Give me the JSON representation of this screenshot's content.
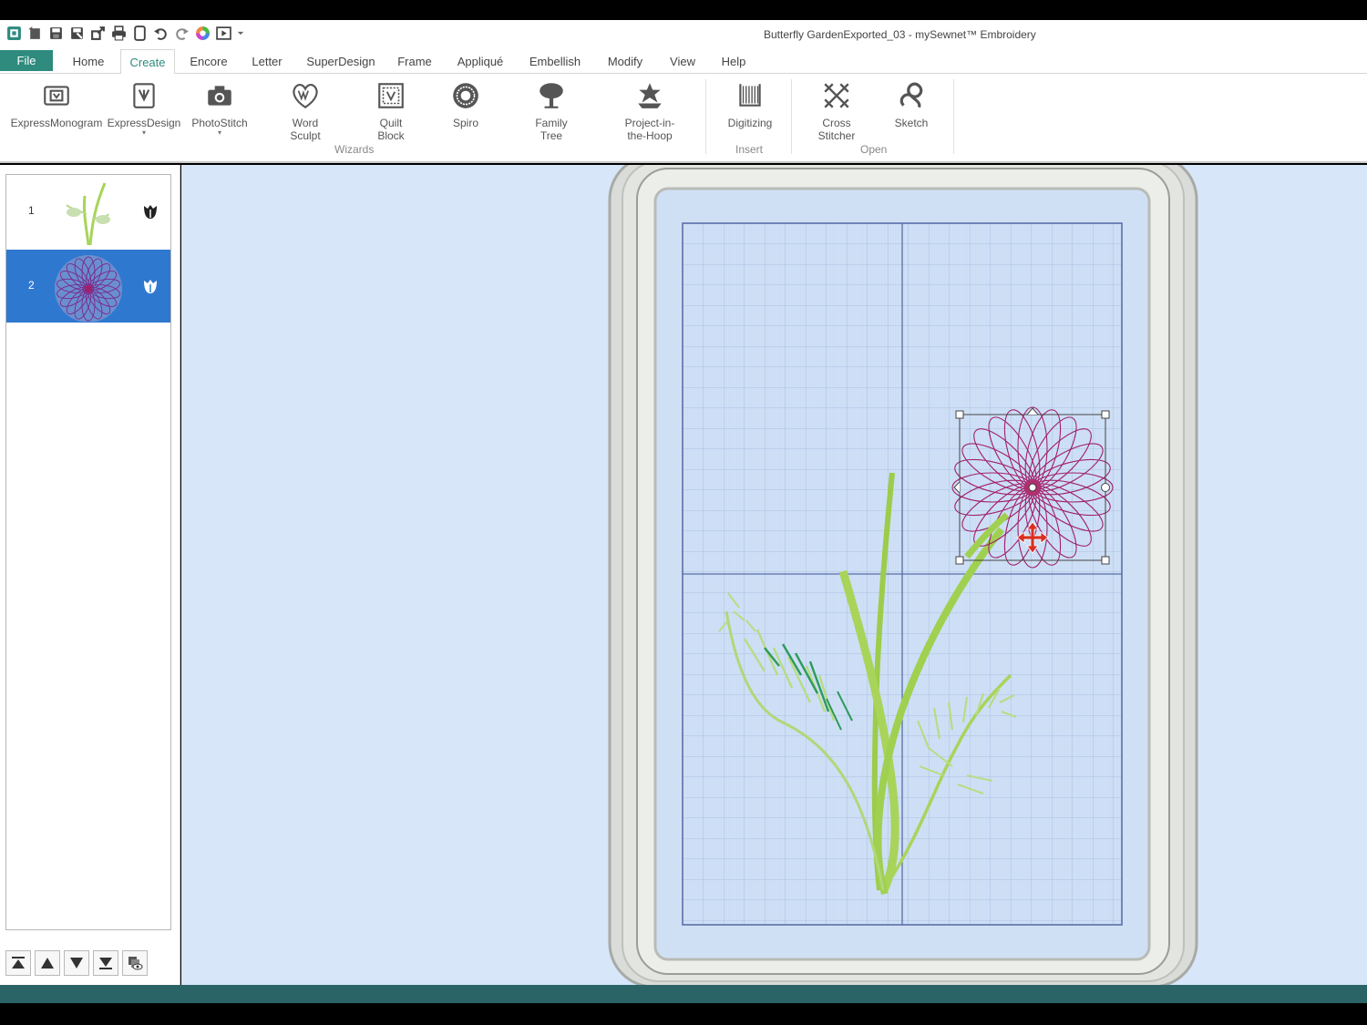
{
  "window_title": "Butterfly GardenExported_03 - mySewnet™ Embroidery",
  "quick_access": [
    {
      "name": "app-icon"
    },
    {
      "name": "new-icon"
    },
    {
      "name": "save-icon"
    },
    {
      "name": "save-as-icon"
    },
    {
      "name": "export-icon"
    },
    {
      "name": "print-icon"
    },
    {
      "name": "hoop-icon"
    },
    {
      "name": "undo-icon"
    },
    {
      "name": "redo-icon"
    },
    {
      "name": "color-wheel-icon"
    },
    {
      "name": "stitchout-icon"
    },
    {
      "name": "customize-dropdown-icon"
    }
  ],
  "tabs": [
    "File",
    "Home",
    "Create",
    "Encore",
    "Letter",
    "SuperDesign",
    "Frame",
    "Appliqué",
    "Embellish",
    "Modify",
    "View",
    "Help"
  ],
  "active_tab": "Create",
  "ribbon": {
    "buttons": [
      {
        "label": "ExpressMonogram",
        "icon": "express-monogram-icon",
        "dropdown": false
      },
      {
        "label": "ExpressDesign",
        "icon": "express-design-icon",
        "dropdown": true
      },
      {
        "label": "PhotoStitch",
        "icon": "camera-icon",
        "dropdown": true
      },
      {
        "label": "Word\nSculpt",
        "icon": "word-sculpt-icon",
        "dropdown": false
      },
      {
        "label": "Quilt\nBlock",
        "icon": "quilt-block-icon",
        "dropdown": false
      },
      {
        "label": "Spiro",
        "icon": "spiro-icon",
        "dropdown": false
      },
      {
        "label": "Family\nTree",
        "icon": "tree-icon",
        "dropdown": false
      },
      {
        "label": "Project-in-\nthe-Hoop",
        "icon": "project-hoop-icon",
        "dropdown": false
      },
      {
        "label": "Digitizing",
        "icon": "digitizing-icon",
        "dropdown": false
      },
      {
        "label": "Cross\nStitcher",
        "icon": "cross-stitch-icon",
        "dropdown": false
      },
      {
        "label": "Sketch",
        "icon": "sketch-icon",
        "dropdown": false
      }
    ],
    "groups": [
      "Wizards",
      "Insert",
      "Open"
    ]
  },
  "layers": [
    {
      "number": "1",
      "name": "stem-design",
      "selected": false
    },
    {
      "number": "2",
      "name": "spiro-flower",
      "selected": true
    }
  ],
  "panel_tools": [
    {
      "name": "move-to-top-icon"
    },
    {
      "name": "move-up-icon"
    },
    {
      "name": "move-down-icon"
    },
    {
      "name": "move-to-bottom-icon"
    },
    {
      "name": "show-hide-icon"
    }
  ],
  "colors": {
    "accent": "#2e8b7e",
    "selection": "#2f78d0",
    "workspace": "#d7e6f8",
    "flower": "#a0206a",
    "stem": "#a8d45a",
    "statusbar": "#2b6466"
  }
}
